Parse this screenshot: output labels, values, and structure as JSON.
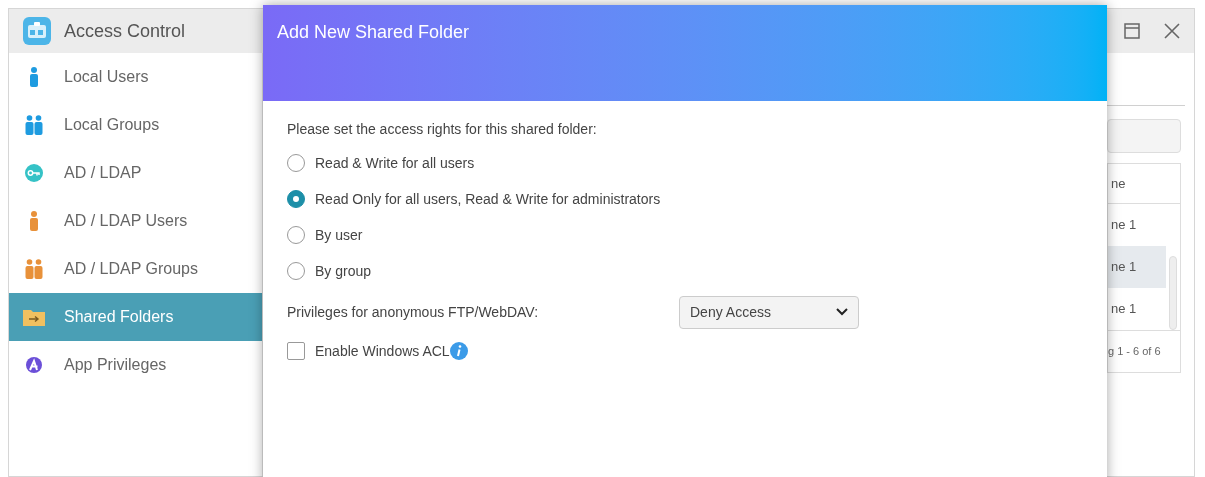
{
  "window": {
    "title": "Access Control"
  },
  "sidebar": {
    "items": [
      {
        "label": "Local Users",
        "kind": "user",
        "color": "#1e9be0",
        "selected": false
      },
      {
        "label": "Local Groups",
        "kind": "group",
        "color": "#1e9be0",
        "selected": false
      },
      {
        "label": "AD / LDAP",
        "kind": "key",
        "color": "#35c2c6",
        "selected": false
      },
      {
        "label": "AD / LDAP Users",
        "kind": "user",
        "color": "#e8913a",
        "selected": false
      },
      {
        "label": "AD / LDAP Groups",
        "kind": "group",
        "color": "#e8913a",
        "selected": false
      },
      {
        "label": "Shared Folders",
        "kind": "folder",
        "color": "#f0c060",
        "selected": true
      },
      {
        "label": "App Privileges",
        "kind": "app",
        "color": "#6b4fd8",
        "selected": false
      }
    ]
  },
  "table": {
    "column_1": "ne",
    "rows": [
      {
        "cell": "ne 1",
        "selected": false
      },
      {
        "cell": "ne 1",
        "selected": true
      },
      {
        "cell": "ne 1",
        "selected": false
      }
    ],
    "footer": "g 1 - 6 of 6"
  },
  "dialog": {
    "title": "Add New Shared Folder",
    "prompt": "Please set the access rights for this shared folder:",
    "options": [
      {
        "label": "Read & Write for all users",
        "selected": false
      },
      {
        "label": "Read Only for all users, Read & Write for administrators",
        "selected": true
      },
      {
        "label": "By user",
        "selected": false
      },
      {
        "label": "By group",
        "selected": false
      }
    ],
    "ftp_label": "Privileges for anonymous FTP/WebDAV:",
    "ftp_select": "Deny Access",
    "acl": {
      "label": "Enable Windows ACL",
      "checked": false
    }
  }
}
